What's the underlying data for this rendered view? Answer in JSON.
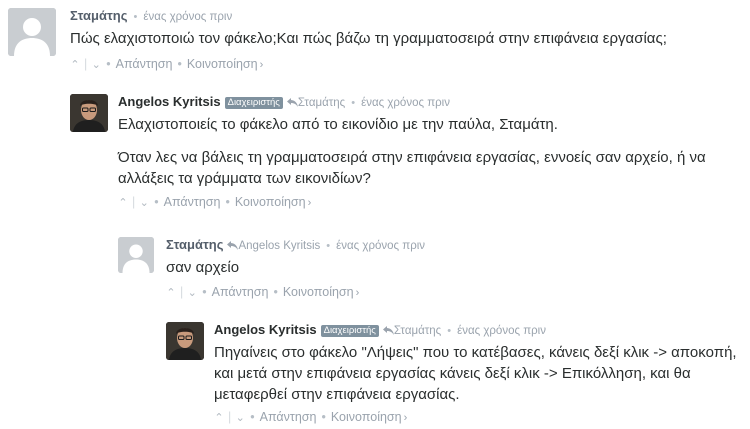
{
  "comments": [
    {
      "author": "Σταμάτης",
      "timestamp": "ένας χρόνος πριν",
      "paragraphs": [
        "Πώς ελαχιστοποιώ τον φάκελο;Και πώς βάζω τη γραμματοσειρά στην επιφάνεια εργασίας;"
      ],
      "actions": {
        "upvote": "⌃",
        "downvote": "⌄",
        "reply": "Απάντηση",
        "share": "Κοινοποίηση",
        "share_chevron": "›"
      }
    },
    {
      "author": "Angelos Kyritsis",
      "badge": "Διαχειριστής",
      "reply_to": "Σταμάτης",
      "timestamp": "ένας χρόνος πριν",
      "paragraphs": [
        "Ελαχιστοποιείς το φάκελο από το εικονίδιο με την παύλα, Σταμάτη.",
        "Όταν λες να βάλεις τη γραμματοσειρά στην επιφάνεια εργασίας, εννοείς σαν αρχείο, ή να αλλάξεις τα γράμματα των εικονιδίων?"
      ],
      "actions": {
        "upvote": "⌃",
        "downvote": "⌄",
        "reply": "Απάντηση",
        "share": "Κοινοποίηση",
        "share_chevron": "›"
      }
    },
    {
      "author": "Σταμάτης",
      "reply_to": "Angelos Kyritsis",
      "timestamp": "ένας χρόνος πριν",
      "paragraphs": [
        "σαν αρχείο"
      ],
      "actions": {
        "upvote": "⌃",
        "downvote": "⌄",
        "reply": "Απάντηση",
        "share": "Κοινοποίηση",
        "share_chevron": "›"
      }
    },
    {
      "author": "Angelos Kyritsis",
      "badge": "Διαχειριστής",
      "reply_to": "Σταμάτης",
      "timestamp": "ένας χρόνος πριν",
      "paragraphs": [
        "Πηγαίνεις στο φάκελο \"Λήψεις\" που το κατέβασες, κάνεις δεξί κλικ -> αποκοπή, και μετά στην επιφάνεια εργασίας κάνεις δεξί κλικ -> Επικόλληση, και θα μεταφερθεί στην επιφάνεια εργασίας."
      ],
      "actions": {
        "upvote": "⌃",
        "downvote": "⌄",
        "reply": "Απάντηση",
        "share": "Κοινοποίηση",
        "share_chevron": "›"
      }
    }
  ],
  "separator": "•",
  "colors": {
    "badge": "#7f919e",
    "meta": "#9aa3ad",
    "text": "#2a2e2e"
  },
  "icons": {
    "default_avatar": "user-silhouette-icon",
    "reply_arrow": "reply-arrow-icon"
  }
}
